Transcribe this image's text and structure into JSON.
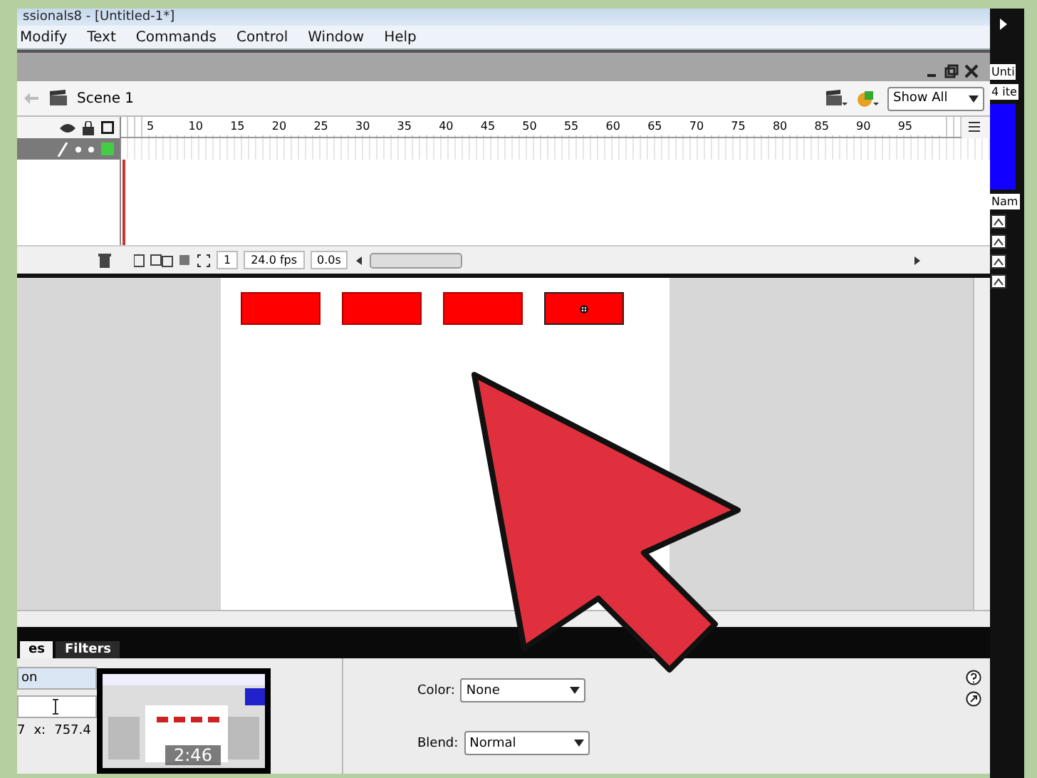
{
  "title_bar": {
    "title": "ssionals8 - [Untitled-1*]"
  },
  "menu": [
    "Modify",
    "Text",
    "Commands",
    "Control",
    "Window",
    "Help"
  ],
  "scene_bar": {
    "scene": "Scene 1",
    "zoom": "Show All"
  },
  "timeline": {
    "frame_numbers": [
      "5",
      "10",
      "15",
      "20",
      "25",
      "30",
      "35",
      "40",
      "45",
      "50",
      "55",
      "60",
      "65",
      "70",
      "75",
      "80",
      "85",
      "90",
      "95"
    ],
    "status": {
      "frame": "1",
      "fps": "24.0 fps",
      "time": "0.0s"
    }
  },
  "stage": {
    "shapes": [
      {
        "selected": false
      },
      {
        "selected": false
      },
      {
        "selected": false
      },
      {
        "selected": true
      }
    ]
  },
  "library": {
    "document": "Unti",
    "count": "4 ite",
    "column": "Nam"
  },
  "properties": {
    "tabs": [
      {
        "label": "es",
        "selected": true
      },
      {
        "label": "Filters",
        "selected": false
      }
    ],
    "name_label": "on",
    "x_row": [
      "7",
      "x:",
      "757.4"
    ],
    "video_time": "2:46",
    "color_label": "Color:",
    "color_value": "None",
    "blend_label": "Blend:",
    "blend_value": "Normal"
  }
}
